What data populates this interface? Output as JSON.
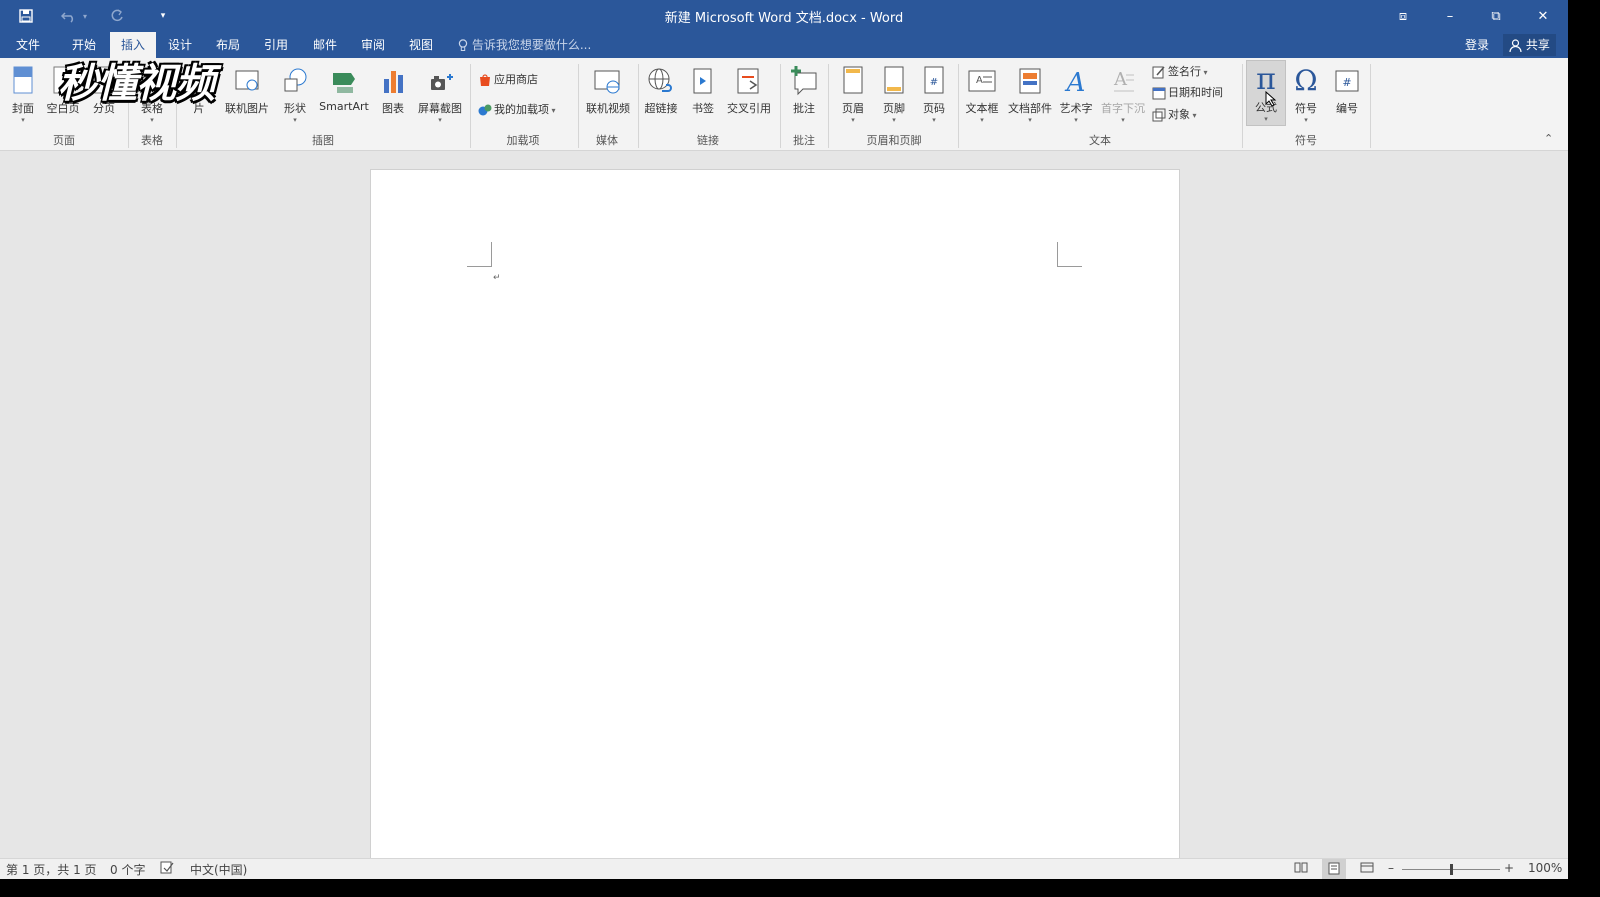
{
  "window": {
    "title": "新建 Microsoft Word 文档.docx - Word",
    "quick_access": {
      "save_icon": "save-icon",
      "undo_icon": "undo-icon",
      "redo_icon": "redo-icon",
      "customize_icon": "customize-icon"
    },
    "controls": {
      "ribbon_display": "⧈",
      "minimize": "–",
      "restore": "⧉",
      "close": "✕"
    }
  },
  "menu": {
    "tabs": [
      "文件",
      "开始",
      "插入",
      "设计",
      "布局",
      "引用",
      "邮件",
      "审阅",
      "视图"
    ],
    "active_tab": "插入",
    "tell_me": "告诉我您想要做什么...",
    "sign_in": "登录",
    "share": "共享"
  },
  "watermark": {
    "text": "秒懂视频"
  },
  "ribbon": {
    "pages": {
      "cover": "封面",
      "blank": "空白页",
      "break": "分页",
      "group": "页面"
    },
    "tables": {
      "table": "表格",
      "group": "表格"
    },
    "illustrations": {
      "pictures": "片",
      "online_pictures": "联机图片",
      "shapes": "形状",
      "smartart": "SmartArt",
      "chart": "图表",
      "screenshot": "屏幕截图",
      "group": "插图"
    },
    "addins": {
      "store": "应用商店",
      "my_addins": "我的加载项",
      "group": "加载项"
    },
    "media": {
      "online_video": "联机视频",
      "group": "媒体"
    },
    "links": {
      "hyperlink": "超链接",
      "bookmark": "书签",
      "cross_ref": "交叉引用",
      "group": "链接"
    },
    "comments": {
      "comment": "批注",
      "group": "批注"
    },
    "header_footer": {
      "header": "页眉",
      "footer": "页脚",
      "page_number": "页码",
      "group": "页眉和页脚"
    },
    "text": {
      "textbox": "文本框",
      "quick_parts": "文档部件",
      "wordart": "艺术字",
      "drop_cap": "首字下沉",
      "signature": "签名行",
      "datetime": "日期和时间",
      "object": "对象",
      "group": "文本"
    },
    "symbols": {
      "equation": "公式",
      "symbol": "符号",
      "number": "编号",
      "group": "符号",
      "equation_glyph": "π",
      "symbol_glyph": "Ω"
    }
  },
  "document": {
    "paragraph_mark": "↵"
  },
  "status": {
    "page": "第 1 页，共 1 页",
    "words": "0 个字",
    "language": "中文(中国)",
    "zoom": "100%",
    "zoom_level": 1.0
  }
}
